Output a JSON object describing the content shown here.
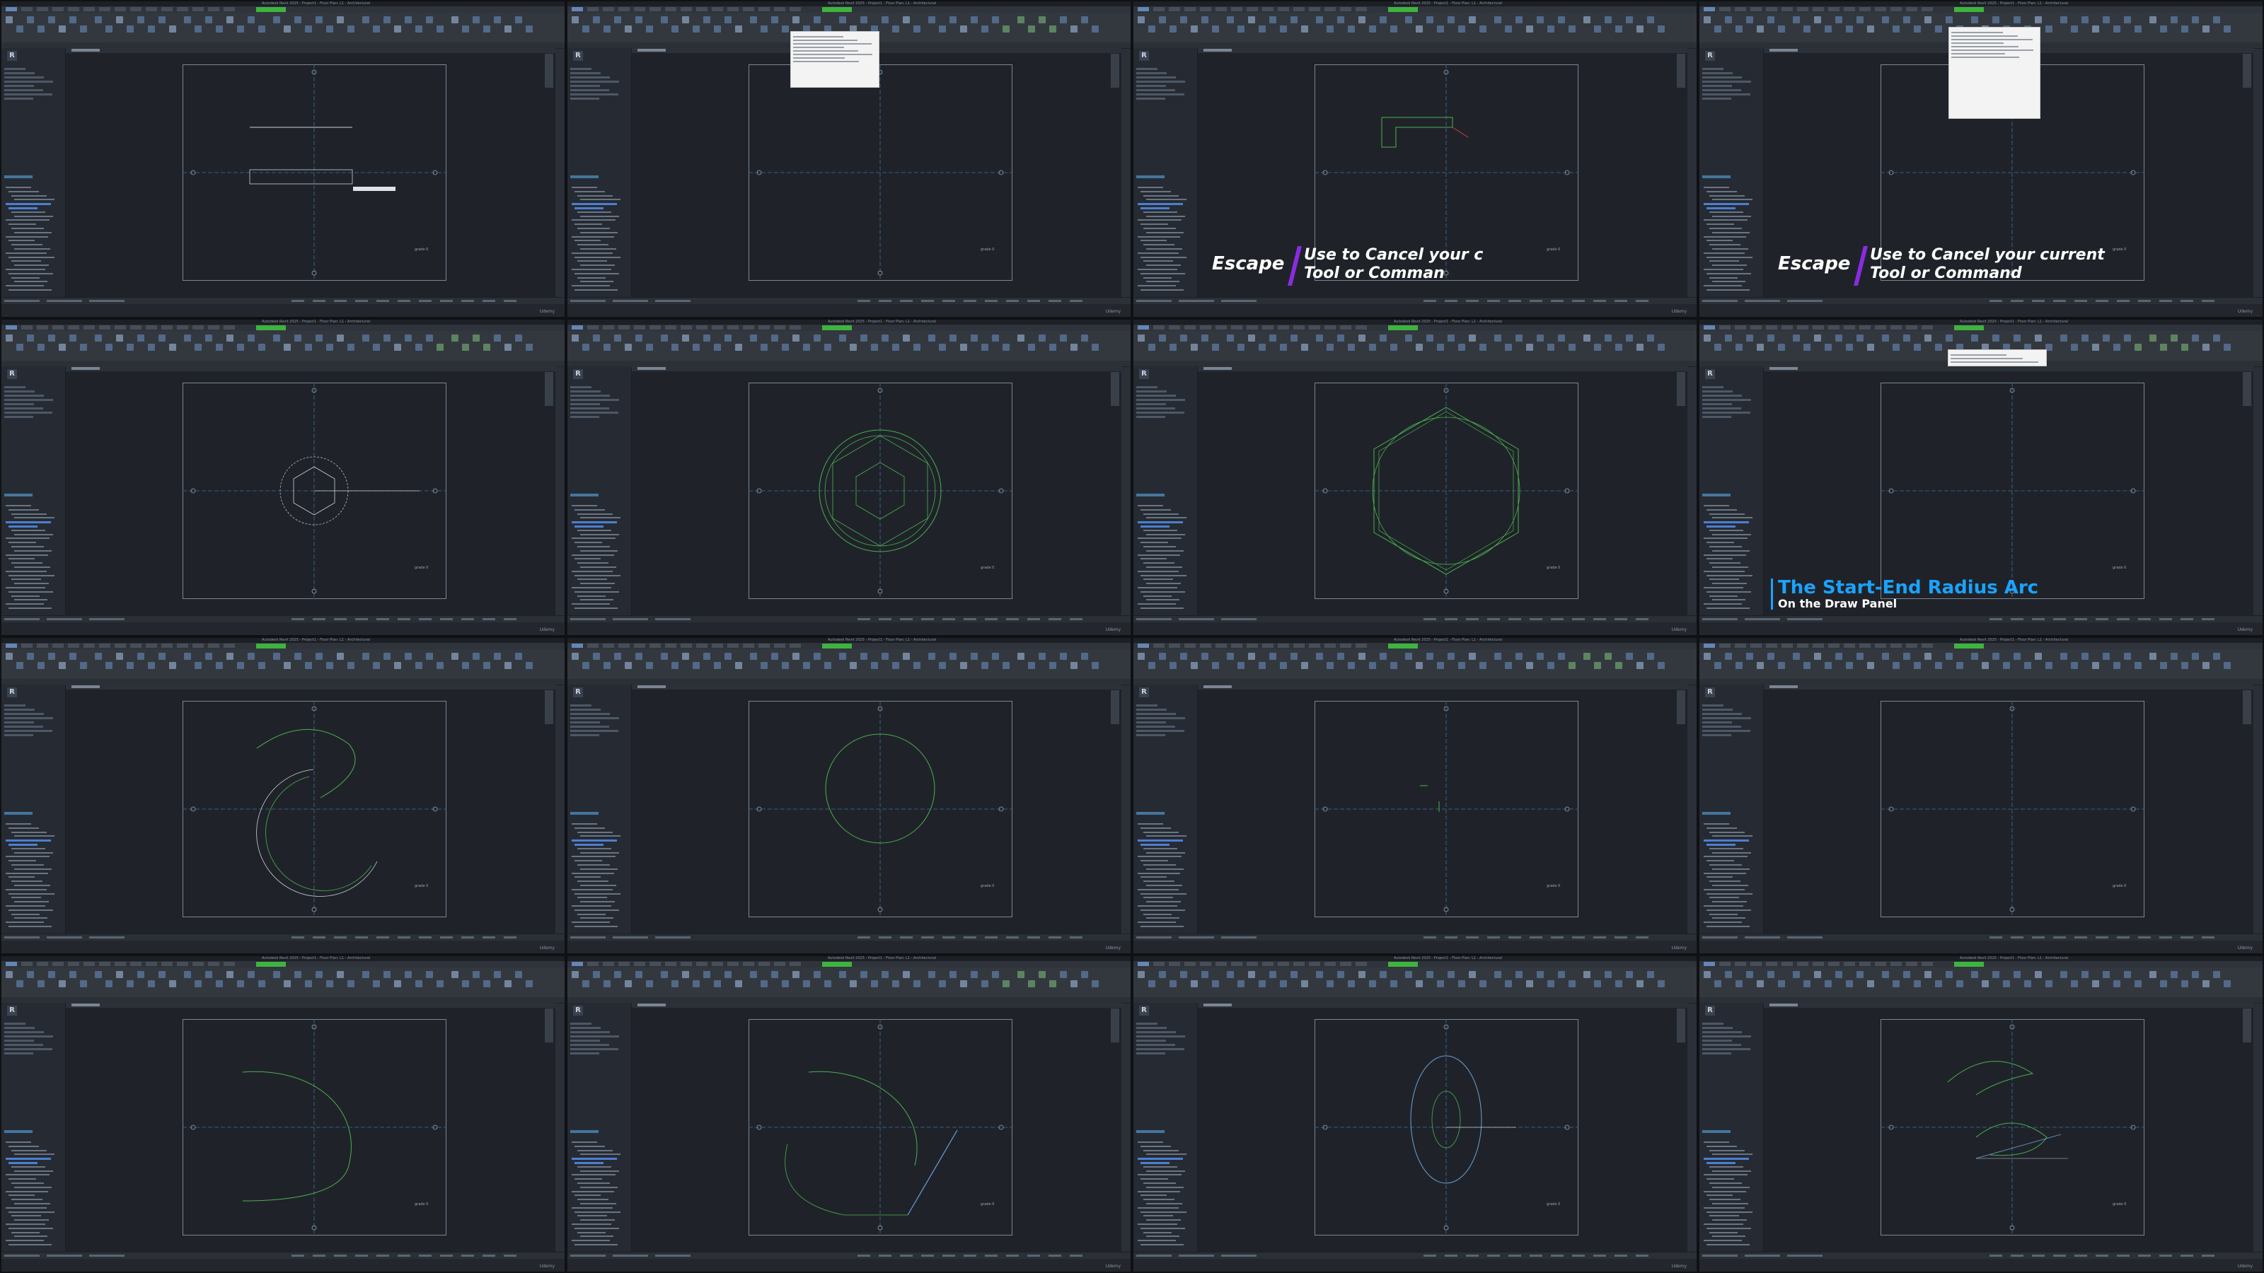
{
  "app": {
    "title": "Autodesk Revit 2025 - Project1 - Floor Plan: L1 - Architectural",
    "menu_items": [
      "File",
      "Architecture",
      "Structure",
      "Steel",
      "Precast",
      "Systems",
      "Insert",
      "Annotate",
      "Analyze",
      "Massing & Site",
      "Collaborate",
      "View",
      "Manage",
      "Add-Ins",
      "Modify"
    ],
    "active_tab": "Modify | Place Lines",
    "view_tab": "Architectural",
    "watermark": "Udemy",
    "logo_letter": "R"
  },
  "panels": [
    {
      "id": 1,
      "caption": null,
      "drawing": "rectangle-lines"
    },
    {
      "id": 2,
      "caption": null,
      "drawing": "empty",
      "tooltip": true
    },
    {
      "id": 3,
      "caption": {
        "key": "Escape",
        "text": [
          "Use to Cancel your c",
          "Tool or Comman"
        ]
      },
      "drawing": "chain-lines"
    },
    {
      "id": 4,
      "caption": {
        "key": "Escape",
        "text": [
          "Use to Cancel your current",
          "Tool or Command"
        ]
      },
      "drawing": "empty",
      "tooltip": true
    },
    {
      "id": 5,
      "caption": null,
      "drawing": "polygon-circle"
    },
    {
      "id": 6,
      "caption": null,
      "drawing": "hexagon-circles"
    },
    {
      "id": 7,
      "caption": null,
      "drawing": "large-hexagon"
    },
    {
      "id": 8,
      "caption": {
        "title": "The Start-End Radius Arc",
        "subtitle": "On the Draw Panel"
      },
      "drawing": "empty",
      "tooltip": true
    },
    {
      "id": 9,
      "caption": null,
      "drawing": "arcs"
    },
    {
      "id": 10,
      "caption": null,
      "drawing": "circle"
    },
    {
      "id": 11,
      "caption": null,
      "drawing": "small-marks"
    },
    {
      "id": 12,
      "caption": null,
      "drawing": "empty"
    },
    {
      "id": 13,
      "caption": null,
      "drawing": "spline"
    },
    {
      "id": 14,
      "caption": null,
      "drawing": "spline-arc"
    },
    {
      "id": 15,
      "caption": null,
      "drawing": "ellipse"
    },
    {
      "id": 16,
      "caption": null,
      "drawing": "partial-ellipse"
    }
  ],
  "colors": {
    "accent_green": "#3fb33f",
    "caption_bar": "#8a2be2",
    "title_blue": "#1aa3ff",
    "sketch_green": "#4caf50"
  }
}
